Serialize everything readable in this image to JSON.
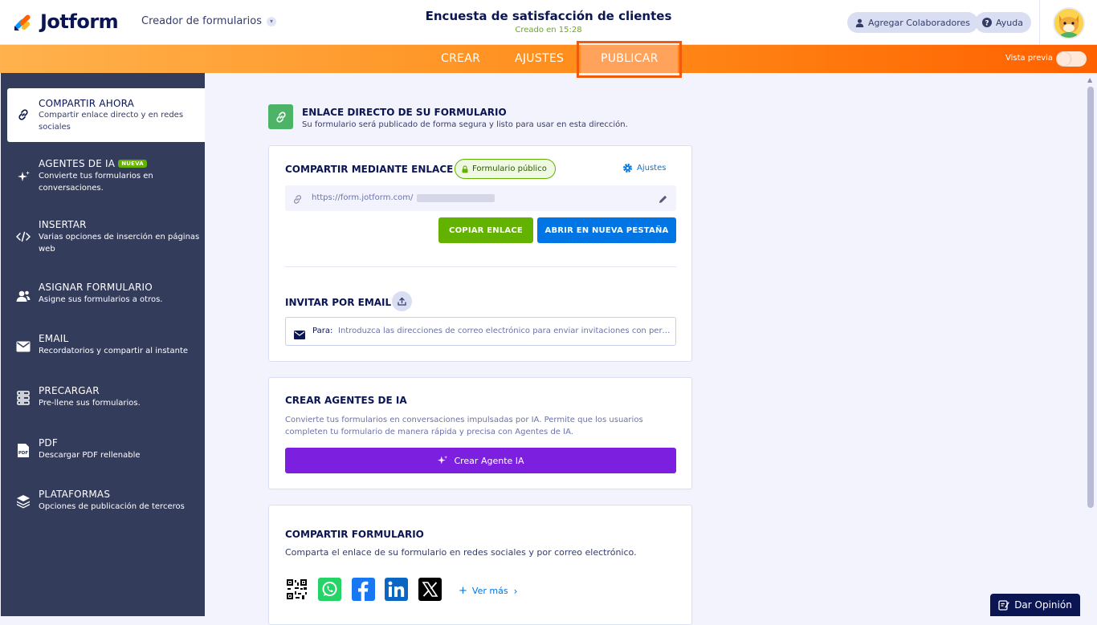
{
  "header": {
    "logo_text": "Jotform",
    "creator_label": "Creador de formularios",
    "form_title": "Encuesta de satisfacción de clientes",
    "created_text": "Creado en 15:28",
    "collaborators_label": "Agregar Colaboradores",
    "help_label": "Ayuda"
  },
  "nav": {
    "tabs": [
      {
        "label": "CREAR"
      },
      {
        "label": "AJUSTES"
      },
      {
        "label": "PUBLICAR",
        "active": true
      }
    ],
    "preview_label": "Vista previa",
    "preview_on": false
  },
  "sidebar": {
    "items": [
      {
        "title": "COMPARTIR AHORA",
        "desc": "Compartir enlace directo y en redes sociales",
        "icon": "link-icon",
        "active": true
      },
      {
        "title": "AGENTES DE IA",
        "badge": "NUEVA",
        "desc": "Convierte tus formularios en conversaciones.",
        "icon": "sparkle-icon"
      },
      {
        "title": "INSERTAR",
        "desc": "Varias opciones de inserción en páginas web",
        "icon": "code-icon"
      },
      {
        "title": "ASIGNAR FORMULARIO",
        "desc": "Asigne sus formularios a otros.",
        "icon": "users-icon"
      },
      {
        "title": "EMAIL",
        "desc": "Recordatorios y compartir al instante",
        "icon": "envelope-icon"
      },
      {
        "title": "PRECARGAR",
        "desc": "Pre-llene sus formularios.",
        "icon": "prefill-icon"
      },
      {
        "title": "PDF",
        "desc": "Descargar PDF rellenable",
        "icon": "pdf-icon"
      },
      {
        "title": "PLATAFORMAS",
        "desc": "Opciones de publicación de terceros",
        "icon": "layers-icon"
      }
    ]
  },
  "main": {
    "section_title": "ENLACE DIRECTO DE SU FORMULARIO",
    "section_sub": "Su formulario será publicado de forma segura y listo para usar en esta dirección.",
    "link_card": {
      "title": "COMPARTIR MEDIANTE ENLACE",
      "public_badge": "Formulario público",
      "settings_label": "Ajustes",
      "url": "https://form.jotform.com/",
      "copy_label": "COPIAR ENLACE",
      "open_label": "ABRIR EN NUEVA PESTAÑA",
      "invite_title": "INVITAR POR EMAIL",
      "to_label": "Para:",
      "email_placeholder": "Introduzca las direcciones de correo electrónico para enviar invitaciones con permiso"
    },
    "ai_card": {
      "title": "CREAR AGENTES DE IA",
      "desc": "Convierte tus formularios en conversaciones impulsadas por IA. Permite que los usuarios completen tu formulario de manera rápida y precisa con Agentes de IA.",
      "button_label": "Crear Agente IA"
    },
    "share_card": {
      "title": "COMPARTIR FORMULARIO",
      "desc": "Comparta el enlace de su formulario en redes sociales y por correo electrónico.",
      "socials": [
        "qr-code-icon",
        "whatsapp-icon",
        "facebook-icon",
        "linkedin-icon",
        "x-icon"
      ],
      "more_label": "Ver más"
    }
  },
  "feedback_label": "Dar Opinión",
  "colors": {
    "accent_orange": "#ff6100",
    "green": "#64b200",
    "blue": "#0075e3",
    "purple": "#7d1fde",
    "navy": "#0a1551",
    "sidebar": "#343c5b"
  }
}
